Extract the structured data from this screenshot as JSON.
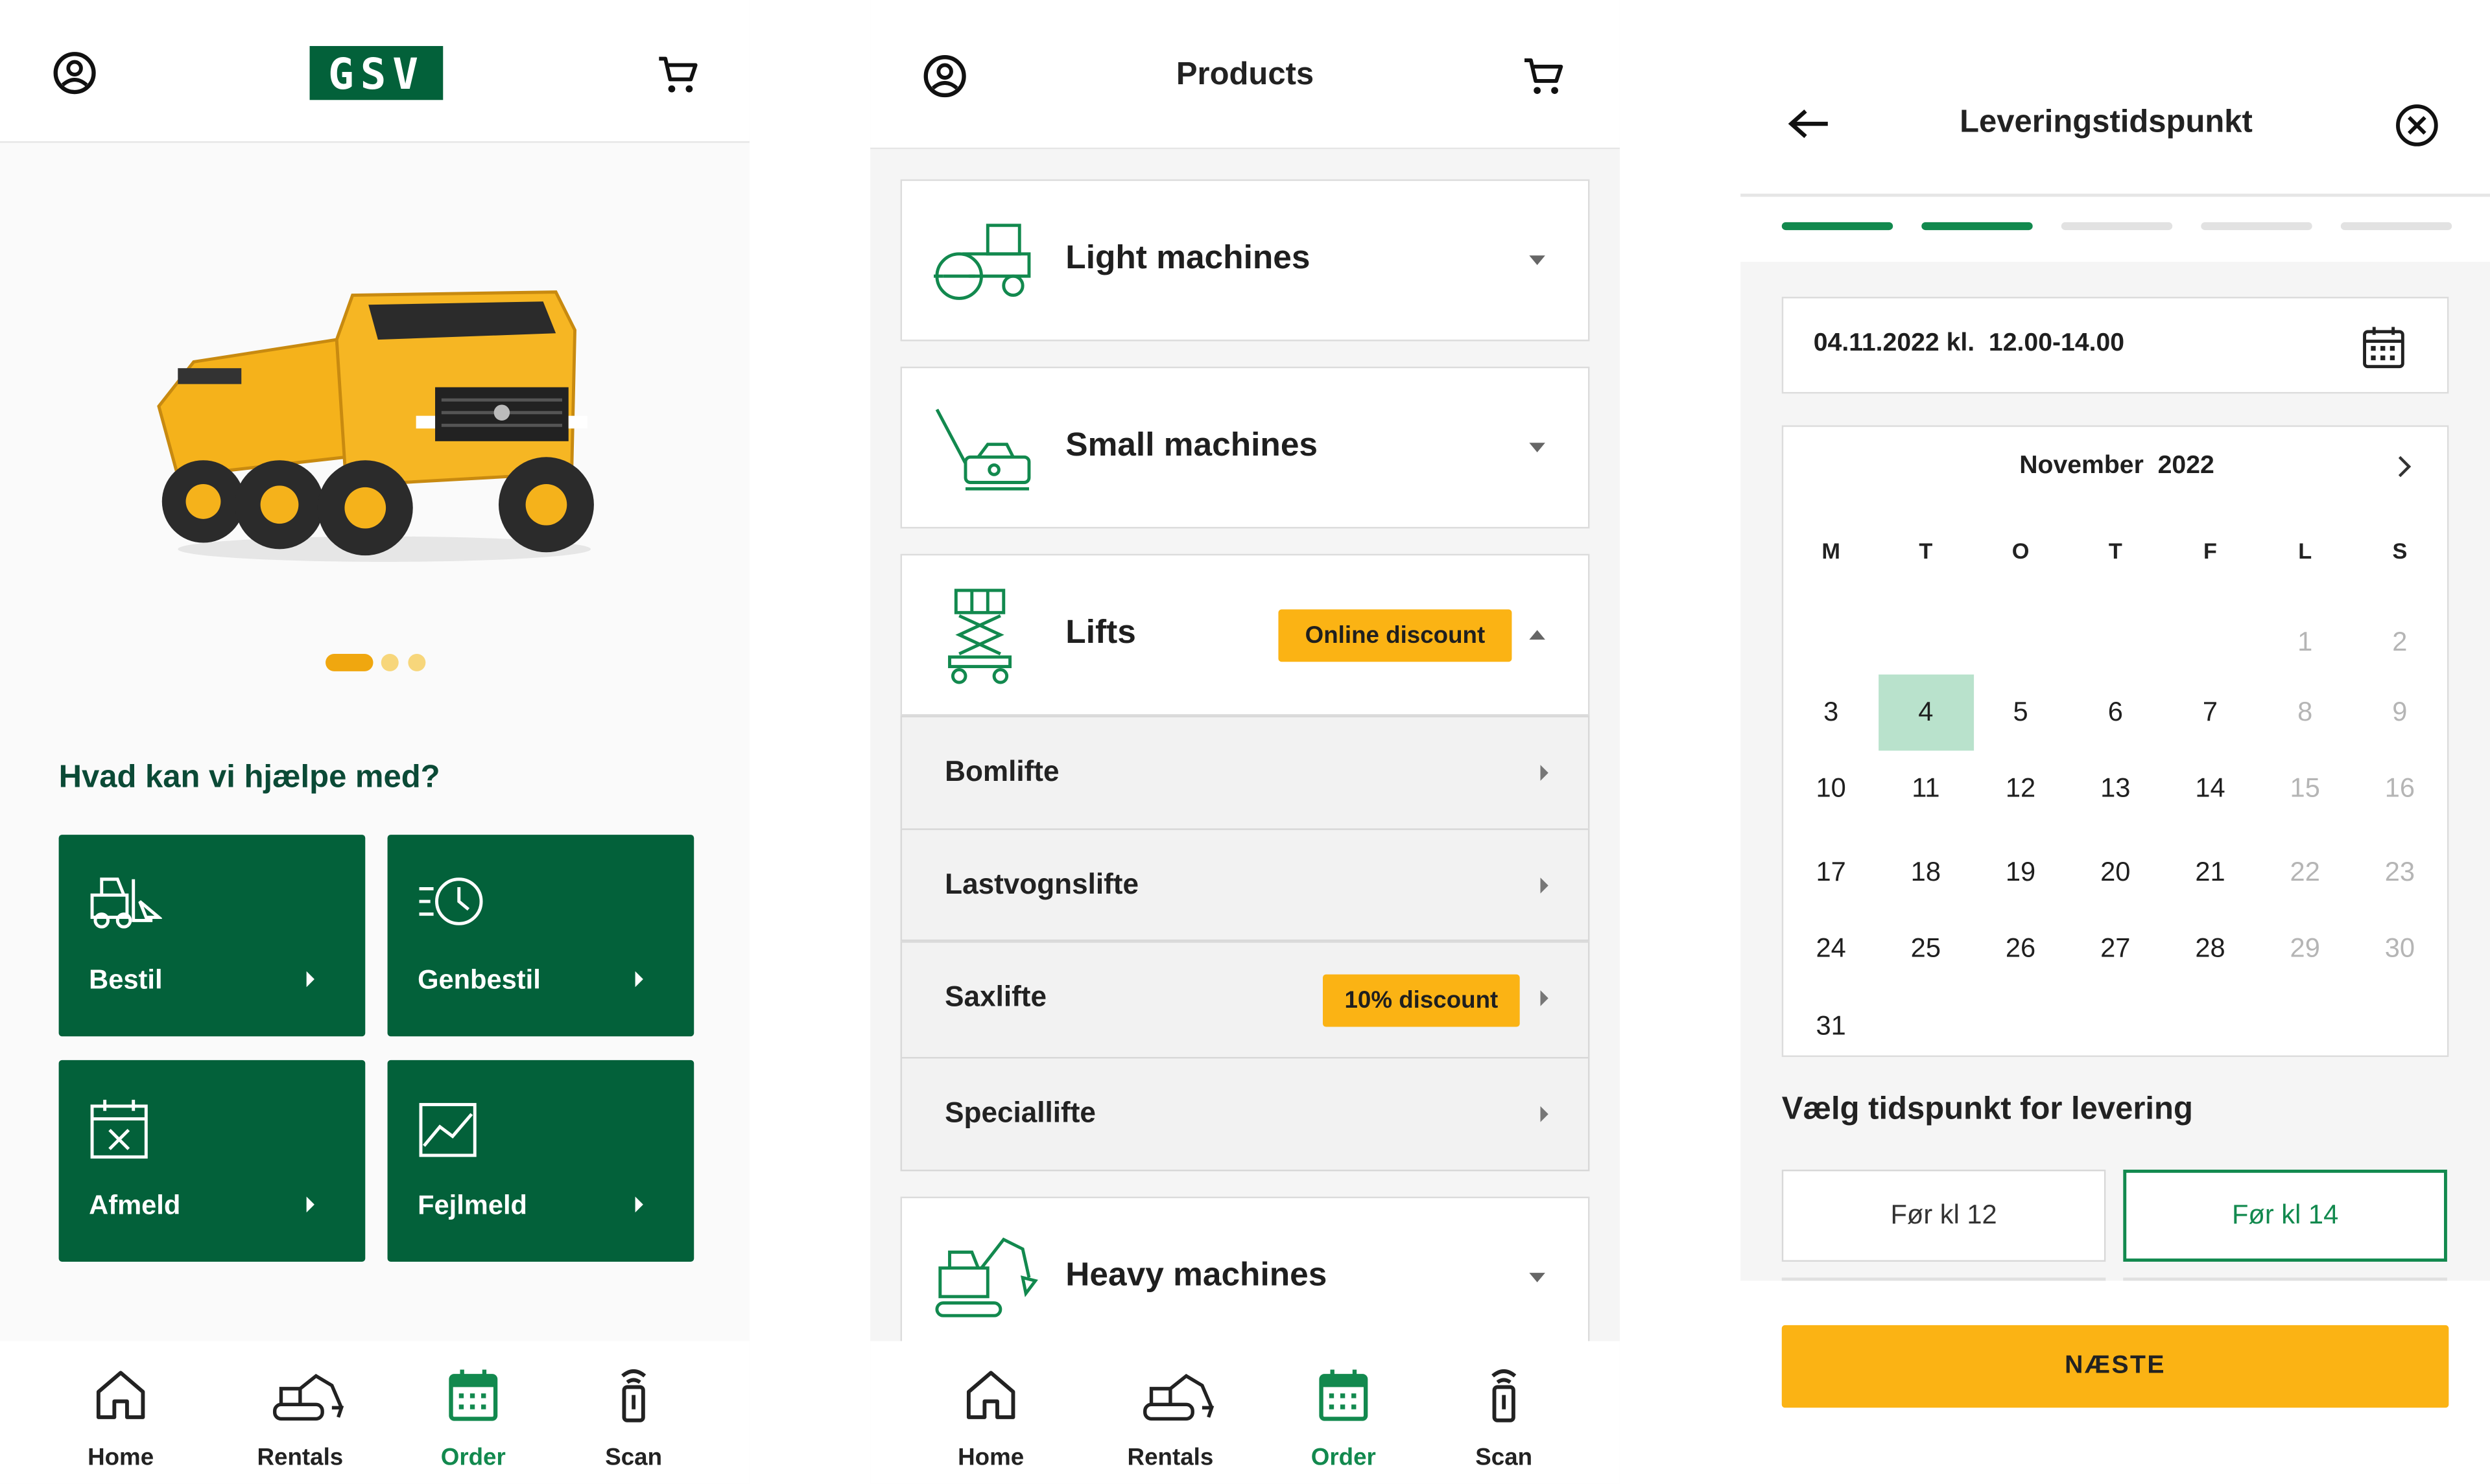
{
  "colors": {
    "brand_green": "#03613a",
    "accent_green": "#12894e",
    "accent_yellow": "#fbb314",
    "dark_text": "#0b4a36"
  },
  "home": {
    "logo_text": "GSV",
    "carousel": {
      "slides": 3,
      "active": 1
    },
    "heading": "Hvad kan vi hjælpe med?",
    "tiles": [
      {
        "label": "Bestil",
        "icon": "forklift-icon"
      },
      {
        "label": "Genbestil",
        "icon": "clock-refresh-icon"
      },
      {
        "label": "Afmeld",
        "icon": "calendar-cancel-icon"
      },
      {
        "label": "Fejlmeld",
        "icon": "chart-icon"
      }
    ]
  },
  "products": {
    "title": "Products",
    "categories": [
      {
        "label": "Light machines",
        "icon": "roller-icon"
      },
      {
        "label": "Small machines",
        "icon": "compactor-icon"
      },
      {
        "label": "Lifts",
        "icon": "scissor-lift-icon",
        "badge": "Online discount"
      },
      {
        "label": "Heavy machines",
        "icon": "excavator-icon"
      }
    ],
    "lift_items": [
      {
        "label": "Bomlifte"
      },
      {
        "label": "Lastvognslifte"
      },
      {
        "label": "Saxlifte",
        "badge": "10% discount"
      },
      {
        "label": "Speciallifte"
      }
    ]
  },
  "nav": {
    "items": [
      {
        "label": "Home",
        "icon": "home-icon"
      },
      {
        "label": "Rentals",
        "icon": "machine-icon"
      },
      {
        "label": "Order",
        "icon": "calendar-icon",
        "active": true
      },
      {
        "label": "Scan",
        "icon": "scanner-icon"
      }
    ]
  },
  "delivery": {
    "title": "Leveringstidspunkt",
    "progress": {
      "steps": 5,
      "done": 2
    },
    "date_field": "04.11.2022 kl.  12.00-14.00",
    "calendar": {
      "month": "November  2022",
      "weekdays": [
        "M",
        "T",
        "O",
        "T",
        "F",
        "L",
        "S"
      ],
      "selected_day": "4",
      "weeks": [
        [
          "",
          "",
          "",
          "",
          "",
          "1",
          "2"
        ],
        [
          "3",
          "4",
          "5",
          "6",
          "7",
          "8",
          "9"
        ],
        [
          "10",
          "11",
          "12",
          "13",
          "14",
          "15",
          "16"
        ],
        [
          "17",
          "18",
          "19",
          "20",
          "21",
          "22",
          "23"
        ],
        [
          "24",
          "25",
          "26",
          "27",
          "28",
          "29",
          "30"
        ],
        [
          "31",
          "",
          "",
          "",
          "",
          "",
          ""
        ]
      ]
    },
    "time_heading": "Vælg tidspunkt for levering",
    "slots": [
      {
        "label": "Før kl 12",
        "selected": false
      },
      {
        "label": "Før kl 14",
        "selected": true
      }
    ],
    "next_button": "NÆSTE"
  }
}
